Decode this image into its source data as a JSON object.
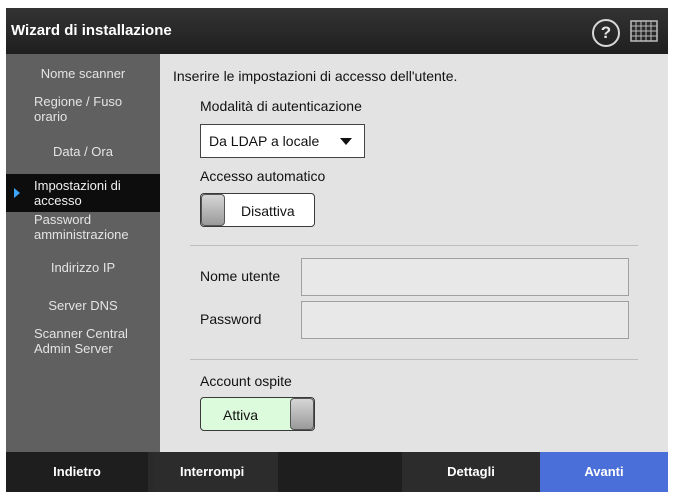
{
  "window": {
    "title": "Wizard di installazione",
    "help_glyph": "?",
    "help_icon": "help-icon",
    "keyboard_icon": "keyboard-icon"
  },
  "sidebar": {
    "items": [
      {
        "label": "Nome scanner",
        "active": false
      },
      {
        "label": "Regione / Fuso orario",
        "active": false
      },
      {
        "label": "Data / Ora",
        "active": false
      },
      {
        "label": "Impostazioni di accesso",
        "active": true
      },
      {
        "label": "Password amministrazione",
        "active": false
      },
      {
        "label": "Indirizzo IP",
        "active": false
      },
      {
        "label": "Server DNS",
        "active": false
      },
      {
        "label": "Scanner Central Admin Server",
        "active": false
      }
    ]
  },
  "main": {
    "instruction": "Inserire le impostazioni di accesso dell'utente.",
    "auth_mode": {
      "label": "Modalità di autenticazione",
      "selected": "Da LDAP a locale"
    },
    "auto_login": {
      "label": "Accesso automatico",
      "state_label": "Disattiva",
      "on": false
    },
    "username": {
      "label": "Nome utente",
      "value": ""
    },
    "password": {
      "label": "Password",
      "value": ""
    },
    "guest_account": {
      "label": "Account ospite",
      "state_label": "Attiva",
      "on": true
    }
  },
  "footer": {
    "back": "Indietro",
    "abort": "Interrompi",
    "details": "Dettagli",
    "next": "Avanti"
  },
  "colors": {
    "active_toggle": "#dcfadc",
    "inactive_toggle": "#ffffff",
    "accent_blue": "#4a6fd8",
    "sidebar_bg": "#606060",
    "active_item_bg": "#0d0d0d"
  }
}
